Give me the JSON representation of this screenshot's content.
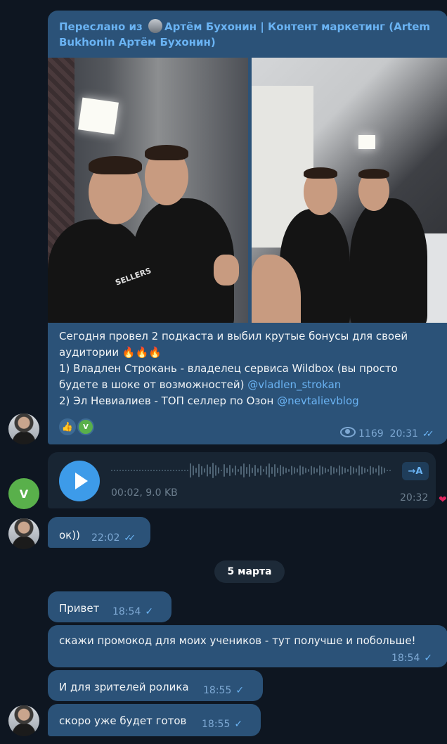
{
  "forwarded_post": {
    "header_prefix": "Переслано из",
    "header_channel": "Артём Бухонин | Контент маркетинг (Artem",
    "header_channel_cont": "Bukhonin Артём Бухонин)",
    "text_line1": "Сегодня провел 2 подкаста и выбил крутые бонусы для своей",
    "text_line2": "аудитории 🔥🔥🔥",
    "text_line3": "1) Владлен Строкань - владелец сервиса Wildbox (вы просто",
    "text_line4a": "будете в шоке от возможностей)",
    "mention1": "@vladlen_strokan",
    "text_line5a": "2) Эл Невиалиев - ТОП селлер по Озон",
    "mention2": "@nevtalievblog",
    "reaction_emoji": "👍",
    "reaction_user_letter": "V",
    "views": "1169",
    "time": "20:31",
    "photo_tshirt_text": "SELLERS"
  },
  "voice_message": {
    "avatar_letter": "V",
    "duration_size": "00:02, 9.0 KB",
    "transcribe_label": "→A",
    "time": "20:32",
    "reaction": "❤"
  },
  "reply_ok": {
    "text": "ок))",
    "time": "22:02"
  },
  "date_separator": "5 марта",
  "messages": [
    {
      "text": "Привет",
      "time": "18:54"
    },
    {
      "text": "скажи промокод для моих учеников - тут получше и побольше!",
      "time": "18:54"
    },
    {
      "text": "И для зрителей ролика",
      "time": "18:55"
    },
    {
      "text": "скоро уже будет готов",
      "time": "18:55"
    }
  ],
  "colors": {
    "background": "#0e1621",
    "outgoing_bubble": "#2b5278",
    "incoming_bubble": "#182533",
    "accent": "#6ab3f3",
    "play_button": "#3d9be9"
  }
}
